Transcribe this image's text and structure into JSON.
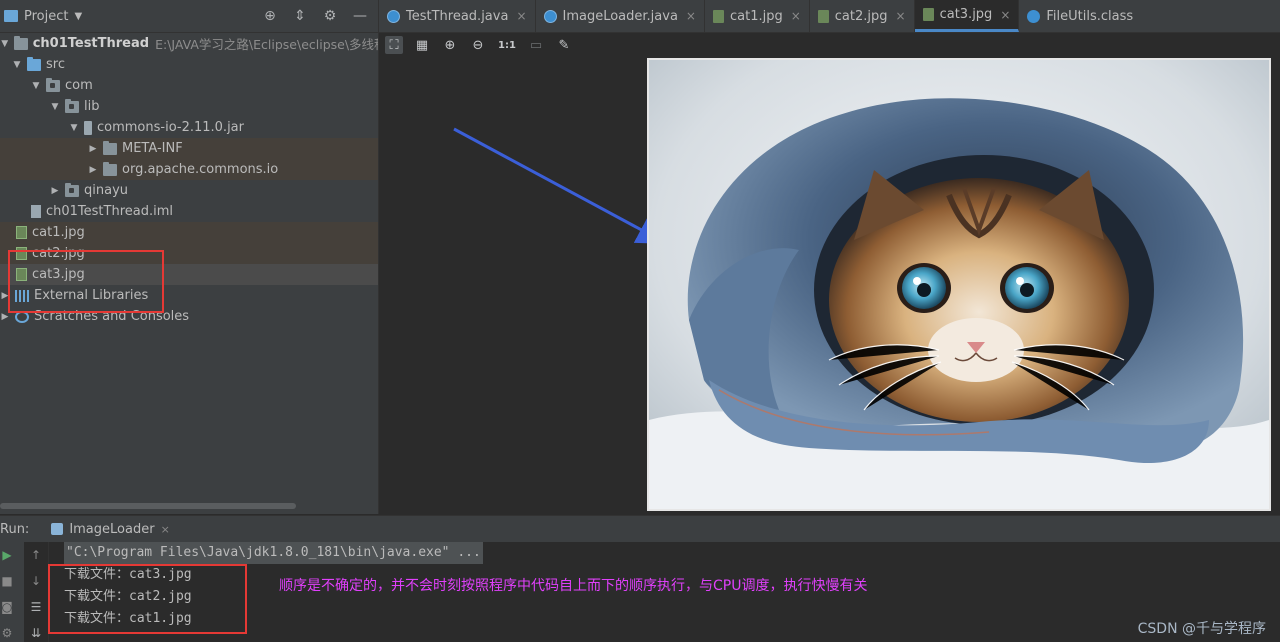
{
  "project_panel": {
    "title": "Project",
    "tree": [
      {
        "label": "ch01TestThread",
        "path": "E:\\JAVA学习之路\\Eclipse\\eclipse\\多线程\\"
      },
      {
        "label": "src"
      },
      {
        "label": "com"
      },
      {
        "label": "lib"
      },
      {
        "label": "commons-io-2.11.0.jar"
      },
      {
        "label": "META-INF"
      },
      {
        "label": "org.apache.commons.io"
      },
      {
        "label": "qinayu"
      },
      {
        "label": "ch01TestThread.iml"
      },
      {
        "label": "cat1.jpg"
      },
      {
        "label": "cat2.jpg"
      },
      {
        "label": "cat3.jpg"
      },
      {
        "label": "External Libraries"
      },
      {
        "label": "Scratches and Consoles"
      }
    ]
  },
  "editor_tabs": [
    {
      "label": "TestThread.java",
      "active": false
    },
    {
      "label": "ImageLoader.java",
      "active": false
    },
    {
      "label": "cat1.jpg",
      "active": false
    },
    {
      "label": "cat2.jpg",
      "active": false
    },
    {
      "label": "cat3.jpg",
      "active": true
    },
    {
      "label": "FileUtils.class",
      "active": false
    }
  ],
  "image_toolbar": {
    "ratio_label": "1:1"
  },
  "run_panel": {
    "run_label": "Run:",
    "tab_label": "ImageLoader",
    "console_lines": [
      "\"C:\\Program Files\\Java\\jdk1.8.0_181\\bin\\java.exe\" ...",
      "下载文件：cat3.jpg",
      "下载文件：cat2.jpg",
      "下载文件：cat1.jpg"
    ]
  },
  "annotation_note": "顺序是不确定的，并不会时刻按照程序中代码自上而下的顺序执行，与CPU调度，执行快慢有关",
  "watermark": "CSDN @千与学程序",
  "colors": {
    "accent": "#4a88c7",
    "highlight_box": "#e53935",
    "note": "#e040fb"
  }
}
